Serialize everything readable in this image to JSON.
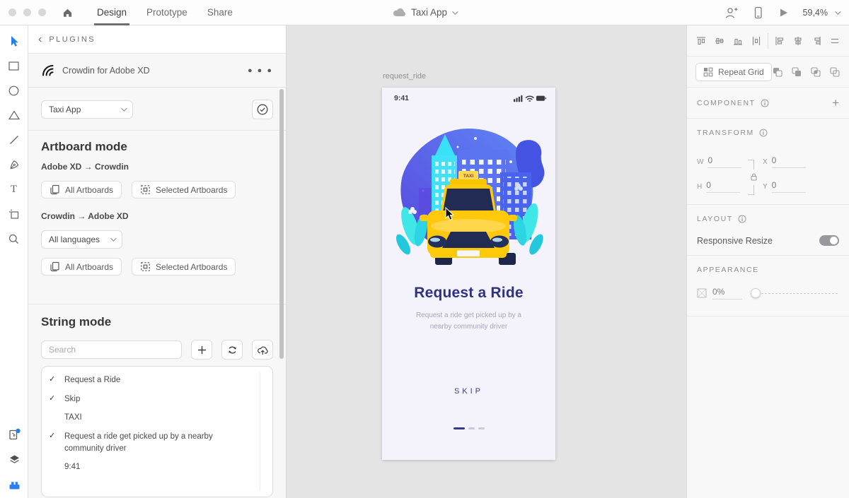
{
  "colors": {
    "accent_blue": "#2680EB",
    "taxi_yellow": "#FFC90B",
    "title_navy": "#2D3282"
  },
  "titlebar": {
    "tabs": [
      {
        "label": "Design"
      },
      {
        "label": "Prototype"
      },
      {
        "label": "Share"
      }
    ],
    "document_title": "Taxi App",
    "zoom_level": "59,4%"
  },
  "plugin_panel": {
    "back_chevron": "‹",
    "header_label": "PLUGINS",
    "plugin_title": "Crowdin for Adobe XD",
    "overflow_menu": "● ● ●",
    "project_select_value": "Taxi App",
    "artboard_mode": {
      "title": "Artboard mode",
      "direction_1": "Adobe XD → Crowdin",
      "direction_2": "Crowdin → Adobe XD",
      "all_artboards_label": "All Artboards",
      "selected_artboards_label": "Selected Artboards",
      "languages_select_value": "All languages"
    },
    "string_mode": {
      "title": "String mode",
      "search_placeholder": "Search",
      "strings": [
        {
          "check": "✓",
          "text": "Request a Ride"
        },
        {
          "check": "✓",
          "text": "Skip"
        },
        {
          "check": "",
          "text": "TAXI"
        },
        {
          "check": "✓",
          "text": "Request a ride get picked up by a nearby community driver"
        },
        {
          "check": "",
          "text": "9:41"
        }
      ]
    }
  },
  "canvas": {
    "artboard_name": "request_ride",
    "phone": {
      "status_time": "9:41",
      "taxi_sign_text": "TAXI",
      "title": "Request a Ride",
      "subtitle": "Request a ride get picked up by a nearby community driver",
      "skip_label": "SKIP"
    }
  },
  "inspector": {
    "repeat_grid_label": "Repeat Grid",
    "component_label": "COMPONENT",
    "add_symbol": "+",
    "transform_label": "TRANSFORM",
    "fields": {
      "w_label": "W",
      "w_value": "0",
      "x_label": "X",
      "x_value": "0",
      "h_label": "H",
      "h_value": "0",
      "y_label": "Y",
      "y_value": "0"
    },
    "layout_label": "LAYOUT",
    "responsive_resize_label": "Responsive Resize",
    "appearance_label": "APPEARANCE",
    "opacity_value": "0%"
  }
}
